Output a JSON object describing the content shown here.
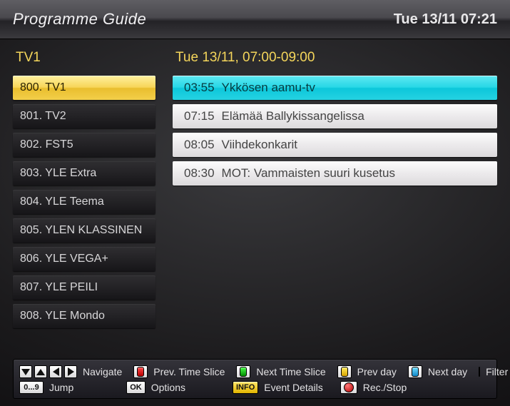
{
  "header": {
    "title": "Programme Guide",
    "clock": "Tue 13/11 07:21"
  },
  "left_header": "TV1",
  "right_header": "Tue 13/11, 07:00-09:00",
  "channels": [
    {
      "label": "800. TV1",
      "selected": true
    },
    {
      "label": "801. TV2",
      "selected": false
    },
    {
      "label": "802. FST5",
      "selected": false
    },
    {
      "label": "803. YLE Extra",
      "selected": false
    },
    {
      "label": "804. YLE Teema",
      "selected": false
    },
    {
      "label": "805. YLEN KLASSINEN",
      "selected": false
    },
    {
      "label": "806. YLE VEGA+",
      "selected": false
    },
    {
      "label": "807. YLE PEILI",
      "selected": false
    },
    {
      "label": "808. YLE Mondo",
      "selected": false
    }
  ],
  "programmes": [
    {
      "time": "03:55",
      "title": "Ykkösen aamu-tv",
      "selected": true
    },
    {
      "time": "07:15",
      "title": "Elämää Ballykissangelissa",
      "selected": false
    },
    {
      "time": "08:05",
      "title": "Viihdekonkarit",
      "selected": false
    },
    {
      "time": "08:30",
      "title": "MOT: Vammaisten suuri kusetus",
      "selected": false
    }
  ],
  "footer": {
    "navigate": "Navigate",
    "prev_slice": "Prev. Time Slice",
    "next_slice": "Next Time Slice",
    "prev_day": "Prev day",
    "next_day": "Next day",
    "filter": "Filter",
    "jump_key": "0...9",
    "jump": "Jump",
    "ok_key": "OK",
    "options": "Options",
    "info_key": "INFO",
    "event_details": "Event Details",
    "rec_stop": "Rec./Stop"
  }
}
